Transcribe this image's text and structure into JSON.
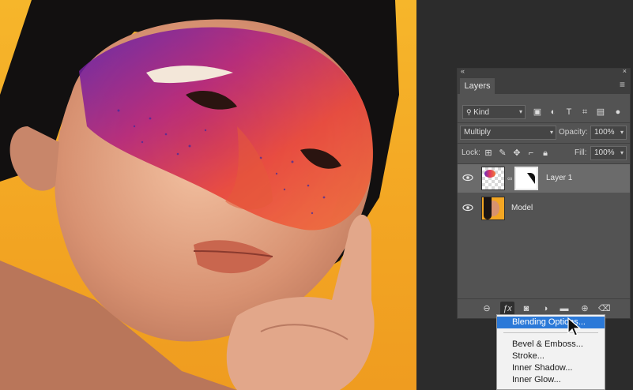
{
  "panel": {
    "title_tab": "Layers",
    "menu_icon": "hamburger-icon",
    "filter": {
      "kind_value": "Kind",
      "icons": [
        "image-filter-icon",
        "adjustment-filter-icon",
        "type-filter-icon",
        "shape-filter-icon",
        "smart-object-filter-icon"
      ]
    },
    "blend": {
      "mode": "Multiply",
      "opacity_label": "Opacity:",
      "opacity_value": "100%"
    },
    "lock": {
      "label": "Lock:",
      "fill_label": "Fill:",
      "fill_value": "100%"
    },
    "layers": [
      {
        "name": "Layer 1",
        "visible": true,
        "selected": true,
        "has_mask": true
      },
      {
        "name": "Model",
        "visible": true,
        "selected": false,
        "has_mask": false
      }
    ],
    "bottom_icons": [
      "link-layers-icon",
      "fx-icon",
      "add-mask-icon",
      "adjustment-layer-icon",
      "new-group-icon",
      "new-layer-icon",
      "delete-layer-icon"
    ]
  },
  "fx_menu": {
    "items": [
      "Blending Options...",
      "Bevel & Emboss...",
      "Stroke...",
      "Inner Shadow...",
      "Inner Glow..."
    ],
    "highlighted_index": 0
  },
  "colors": {
    "background": "#f3a623",
    "panel": "#535353",
    "selection": "#2b79d8"
  }
}
